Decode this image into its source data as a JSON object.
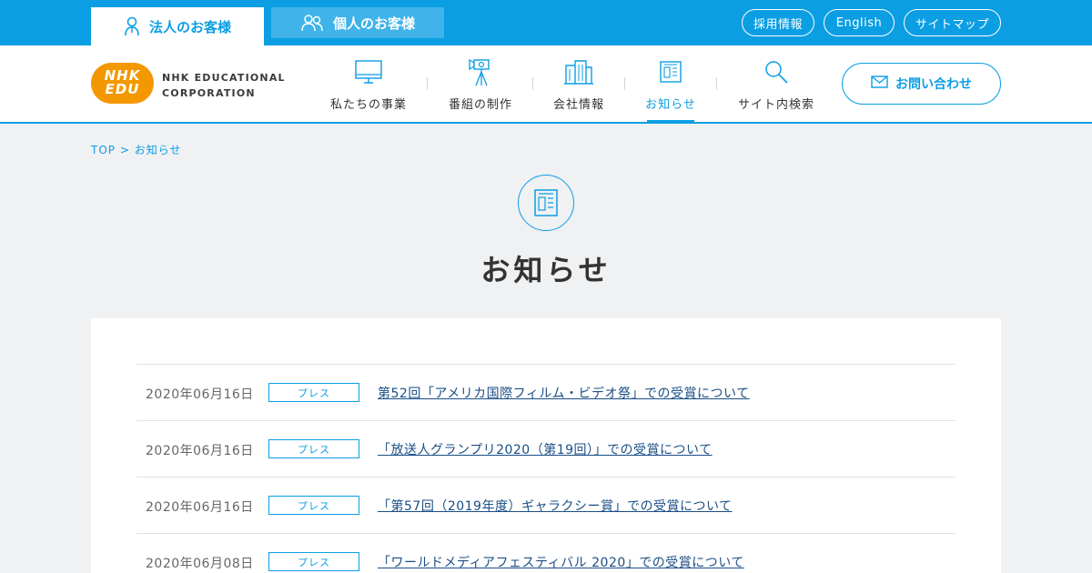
{
  "top_bar": {
    "segments": [
      {
        "label": "法人のお客様",
        "icon": "person-icon",
        "active": true
      },
      {
        "label": "個人のお客様",
        "icon": "people-icon",
        "active": false
      }
    ],
    "links": [
      "採用情報",
      "English",
      "サイトマップ"
    ]
  },
  "logo": {
    "mark_line1": "NHK",
    "mark_line2": "EDU",
    "text_line1": "NHK EDUCATIONAL",
    "text_line2": "CORPORATION"
  },
  "nav": {
    "items": [
      {
        "label": "私たちの事業",
        "icon": "monitor-icon"
      },
      {
        "label": "番組の制作",
        "icon": "video-camera-icon"
      },
      {
        "label": "会社情報",
        "icon": "building-icon"
      },
      {
        "label": "お知らせ",
        "icon": "news-icon",
        "active": true
      },
      {
        "label": "サイト内検索",
        "icon": "search-icon"
      }
    ],
    "contact_label": "お問い合わせ"
  },
  "breadcrumb": {
    "home": "TOP",
    "separator": ">",
    "current": "お知らせ"
  },
  "page_title": "お知らせ",
  "news": [
    {
      "date": "2020年06月16日",
      "tag": "プレス",
      "title": "第52回「アメリカ国際フィルム・ビデオ祭」での受賞について"
    },
    {
      "date": "2020年06月16日",
      "tag": "プレス",
      "title": "「放送人グランプリ2020（第19回）」での受賞について"
    },
    {
      "date": "2020年06月16日",
      "tag": "プレス",
      "title": "「第57回（2019年度）ギャラクシー賞」での受賞について"
    },
    {
      "date": "2020年06月08日",
      "tag": "プレス",
      "title": "「ワールドメディアフェスティバル 2020」での受賞について"
    }
  ],
  "colors": {
    "accent": "#0b9ee3",
    "logo_orange": "#f39800",
    "page_bg": "#eff1f3",
    "link": "#1a4e86"
  }
}
